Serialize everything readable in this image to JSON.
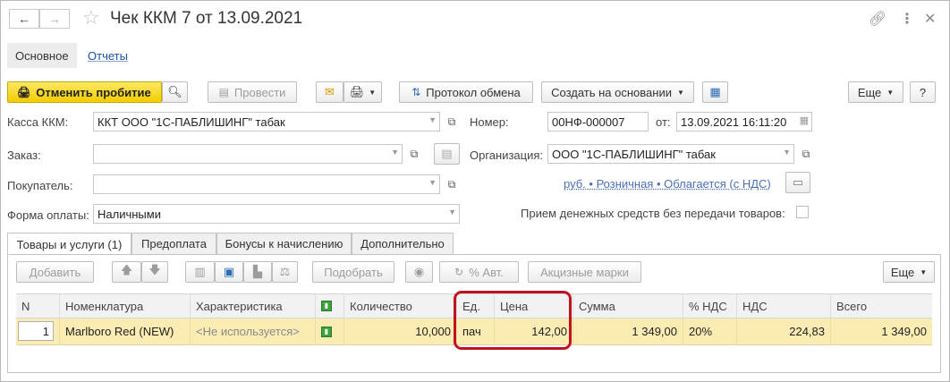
{
  "window": {
    "title": "Чек ККМ 7 от 13.09.2021"
  },
  "sections": {
    "main": "Основное",
    "reports": "Отчеты"
  },
  "toolbar": {
    "cancel_punch": "Отменить пробитие",
    "post": "Провести",
    "exchange_protocol": "Протокол обмена",
    "create_based_on": "Создать на основании",
    "more": "Еще",
    "help": "?"
  },
  "form": {
    "kassa_label": "Касса ККМ:",
    "kassa_value": "ККТ ООО \"1С-ПАБЛИШИНГ\" табак",
    "order_label": "Заказ:",
    "order_value": "",
    "buyer_label": "Покупатель:",
    "buyer_value": "",
    "payment_label": "Форма оплаты:",
    "payment_value": "Наличными",
    "number_label": "Номер:",
    "number_value": "00НФ-000007",
    "date_label": "от:",
    "date_value": "13.09.2021 16:11:20",
    "org_label": "Организация:",
    "org_value": "ООО \"1С-ПАБЛИШИНГ\" табак",
    "price_settings": "руб. • Розничная • Облагается (с НДС)",
    "no_goods_label": "Прием денежных средств без передачи товаров:"
  },
  "tabs": [
    {
      "label": "Товары и услуги (1)",
      "active": true
    },
    {
      "label": "Предоплата",
      "active": false
    },
    {
      "label": "Бонусы к начислению",
      "active": false
    },
    {
      "label": "Дополнительно",
      "active": false
    }
  ],
  "table_toolbar": {
    "add": "Добавить",
    "pick": "Подобрать",
    "auto_percent": "% Авт.",
    "excise_marks": "Акцизные марки",
    "more": "Еще"
  },
  "table": {
    "columns": [
      "N",
      "Номенклатура",
      "Характеристика",
      "",
      "Количество",
      "Ед.",
      "Цена",
      "Сумма",
      "% НДС",
      "НДС",
      "Всего"
    ],
    "rows": [
      {
        "n": "1",
        "item": "Marlboro Red (NEW)",
        "characteristic": "<Не используется>",
        "qty": "10,000",
        "unit": "пач",
        "price": "142,00",
        "sum": "1 349,00",
        "vat_rate": "20%",
        "vat": "224,83",
        "total": "1 349,00"
      }
    ]
  },
  "colors": {
    "highlight": "#c1121f",
    "yellow_button": "#f3cc00",
    "selected_row": "#fbecb3",
    "link": "#1a4fa3"
  }
}
